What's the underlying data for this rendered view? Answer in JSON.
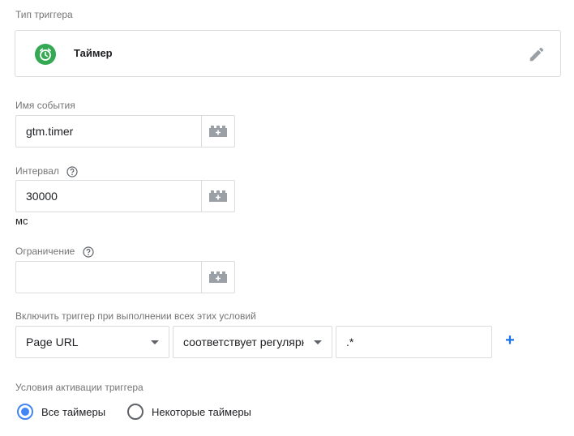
{
  "trigger_type": {
    "label": "Тип триггера",
    "name": "Таймер",
    "icon": "timer-icon",
    "icon_color": "#34a853"
  },
  "event_name": {
    "label": "Имя события",
    "value": "gtm.timer"
  },
  "interval": {
    "label": "Интервал",
    "value": "30000",
    "unit": "мс"
  },
  "limit": {
    "label": "Ограничение",
    "value": ""
  },
  "conditions": {
    "label": "Включить триггер при выполнении всех этих условий",
    "variable": "Page URL",
    "operator": "соответствует регулярному выражению",
    "value": ".*",
    "add_label": "+"
  },
  "activation": {
    "label": "Условия активации триггера",
    "options": [
      {
        "label": "Все таймеры",
        "checked": true
      },
      {
        "label": "Некоторые таймеры",
        "checked": false
      }
    ]
  },
  "colors": {
    "accent": "#4285f4",
    "add_button": "#1a73e8"
  }
}
